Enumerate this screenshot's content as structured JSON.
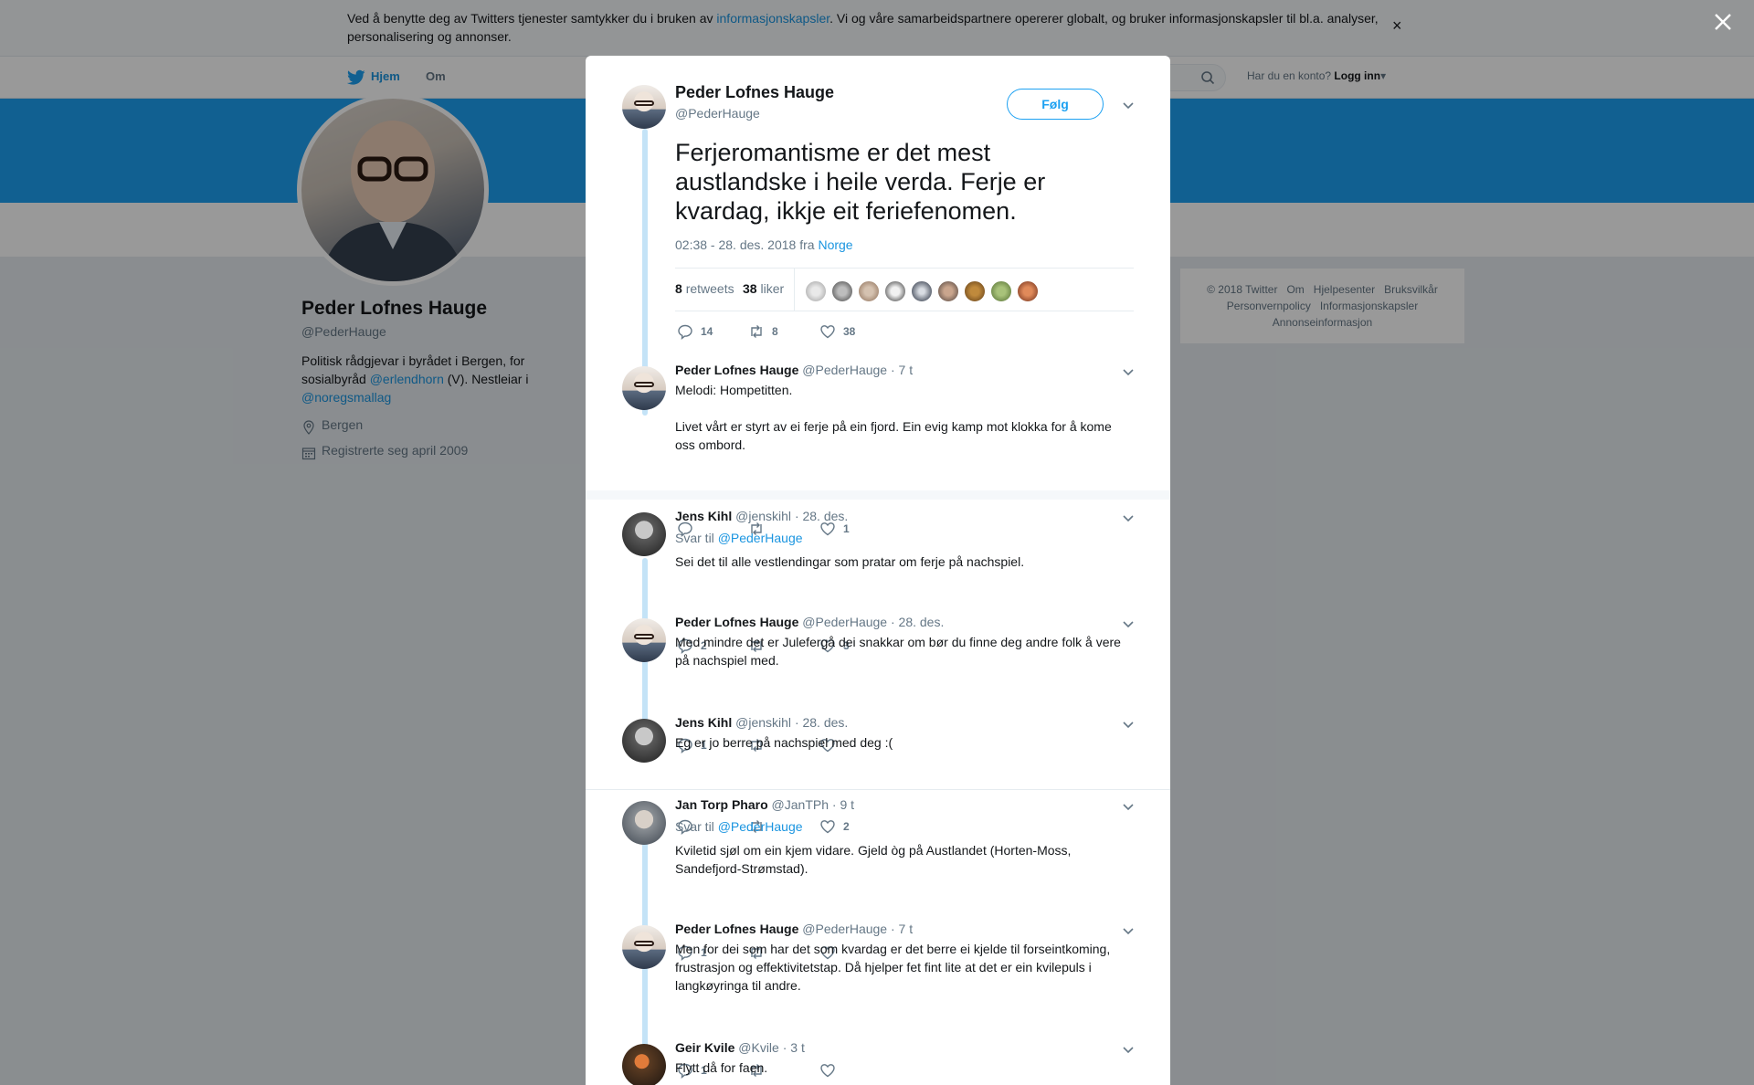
{
  "cookie": {
    "text_before": "Ved å benytte deg av Twitters tjenester samtykker du i bruken av ",
    "link": "informasjonskapsler",
    "text_after": ". Vi og våre samarbeidspartnere opererer globalt, og bruker informasjonskapsler til bl.a. analyser, personalisering og annonser.",
    "close": "×"
  },
  "nav": {
    "home": "Hjem",
    "about": "Om",
    "login_prompt": "Har du en konto?",
    "login": "Logg inn"
  },
  "profile": {
    "name": "Peder Lofnes Hauge",
    "handle": "@PederHauge",
    "bio_1": "Politisk rådgjevar i byrådet i Bergen, for sosialbyråd ",
    "bio_link_1": "@erlendhorn",
    "bio_2": " (V). Nestleiar i ",
    "bio_link_2": "@noregsmallag",
    "location": "Bergen",
    "joined": "Registrerte seg april 2009"
  },
  "footer": {
    "items": [
      "© 2018 Twitter",
      "Om",
      "Hjelpesenter",
      "Bruksvilkår",
      "Personvernpolicy",
      "Informasjonskapsler",
      "Annonseinformasjon"
    ]
  },
  "main_tweet": {
    "name": "Peder Lofnes Hauge",
    "handle": "@PederHauge",
    "follow": "Følg",
    "text": "Ferjeromantisme er det mest austlandske i heile verda. Ferje er kvardag, ikkje eit feriefenomen.",
    "meta": "02:38 - 28. des. 2018 fra ",
    "meta_link": "Norge",
    "retweets_count": "8",
    "retweets_label": "retweets",
    "likes_count": "38",
    "likes_label": "liker",
    "reply_count": "14",
    "retweet_action_count": "8",
    "like_action_count": "38"
  },
  "replies": [
    {
      "name": "Peder Lofnes Hauge",
      "handle": "@PederHauge",
      "time": "· 7 t",
      "text_1": "Melodi: Hompetitten.",
      "text_2": "Livet vårt er styrt av ei ferje på ein fjord. Ein evig kamp mot klokka for å kome oss ombord.",
      "replies": "",
      "retweets": "",
      "likes": "1"
    },
    {
      "name": "Jens Kihl",
      "handle": "@jenskihl",
      "time": "· 28. des.",
      "reply_to_label": "Svar til ",
      "reply_to": "@PederHauge",
      "text_1": "Sei det til alle vestlendingar som pratar om ferje på nachspiel.",
      "replies": "2",
      "retweets": "",
      "likes": "3"
    },
    {
      "name": "Peder Lofnes Hauge",
      "handle": "@PederHauge",
      "time": "· 28. des.",
      "text_1": "Med mindre det er Julefergå dei snakkar om bør du finne deg andre folk å vere på nachspiel med.",
      "replies": "1",
      "retweets": "",
      "likes": ""
    },
    {
      "name": "Jens Kihl",
      "handle": "@jenskihl",
      "time": "· 28. des.",
      "text_1": "Eg er jo berre på nachspiel med deg :(",
      "replies": "",
      "retweets": "",
      "likes": "2"
    },
    {
      "name": "Jan Torp Pharo",
      "handle": "@JanTPh",
      "time": "· 9 t",
      "reply_to_label": "Svar til ",
      "reply_to": "@PederHauge",
      "text_1": "Kviletid sjøl om ein kjem vidare. Gjeld òg på Austlandet (Horten-Moss, Sandefjord-Strømstad).",
      "replies": "1",
      "retweets": "",
      "likes": ""
    },
    {
      "name": "Peder Lofnes Hauge",
      "handle": "@PederHauge",
      "time": "· 7 t",
      "text_1": "Men for dei som har det som kvardag er det berre ei kjelde til forseintkoming, frustrasjon og effektivitetstap. Då hjelper fet fint lite at det er ein kvilepuls i langkøyringa til andre.",
      "replies": "1",
      "retweets": "",
      "likes": ""
    },
    {
      "name": "Geir Kvile",
      "handle": "@Kvile",
      "time": "· 3 t",
      "text_1": "Flytt då for faen."
    }
  ],
  "colors": {
    "accent": "#1da1f2",
    "link": "#1b95e0",
    "thread": "#c4e3f7",
    "muted": "#657786"
  }
}
